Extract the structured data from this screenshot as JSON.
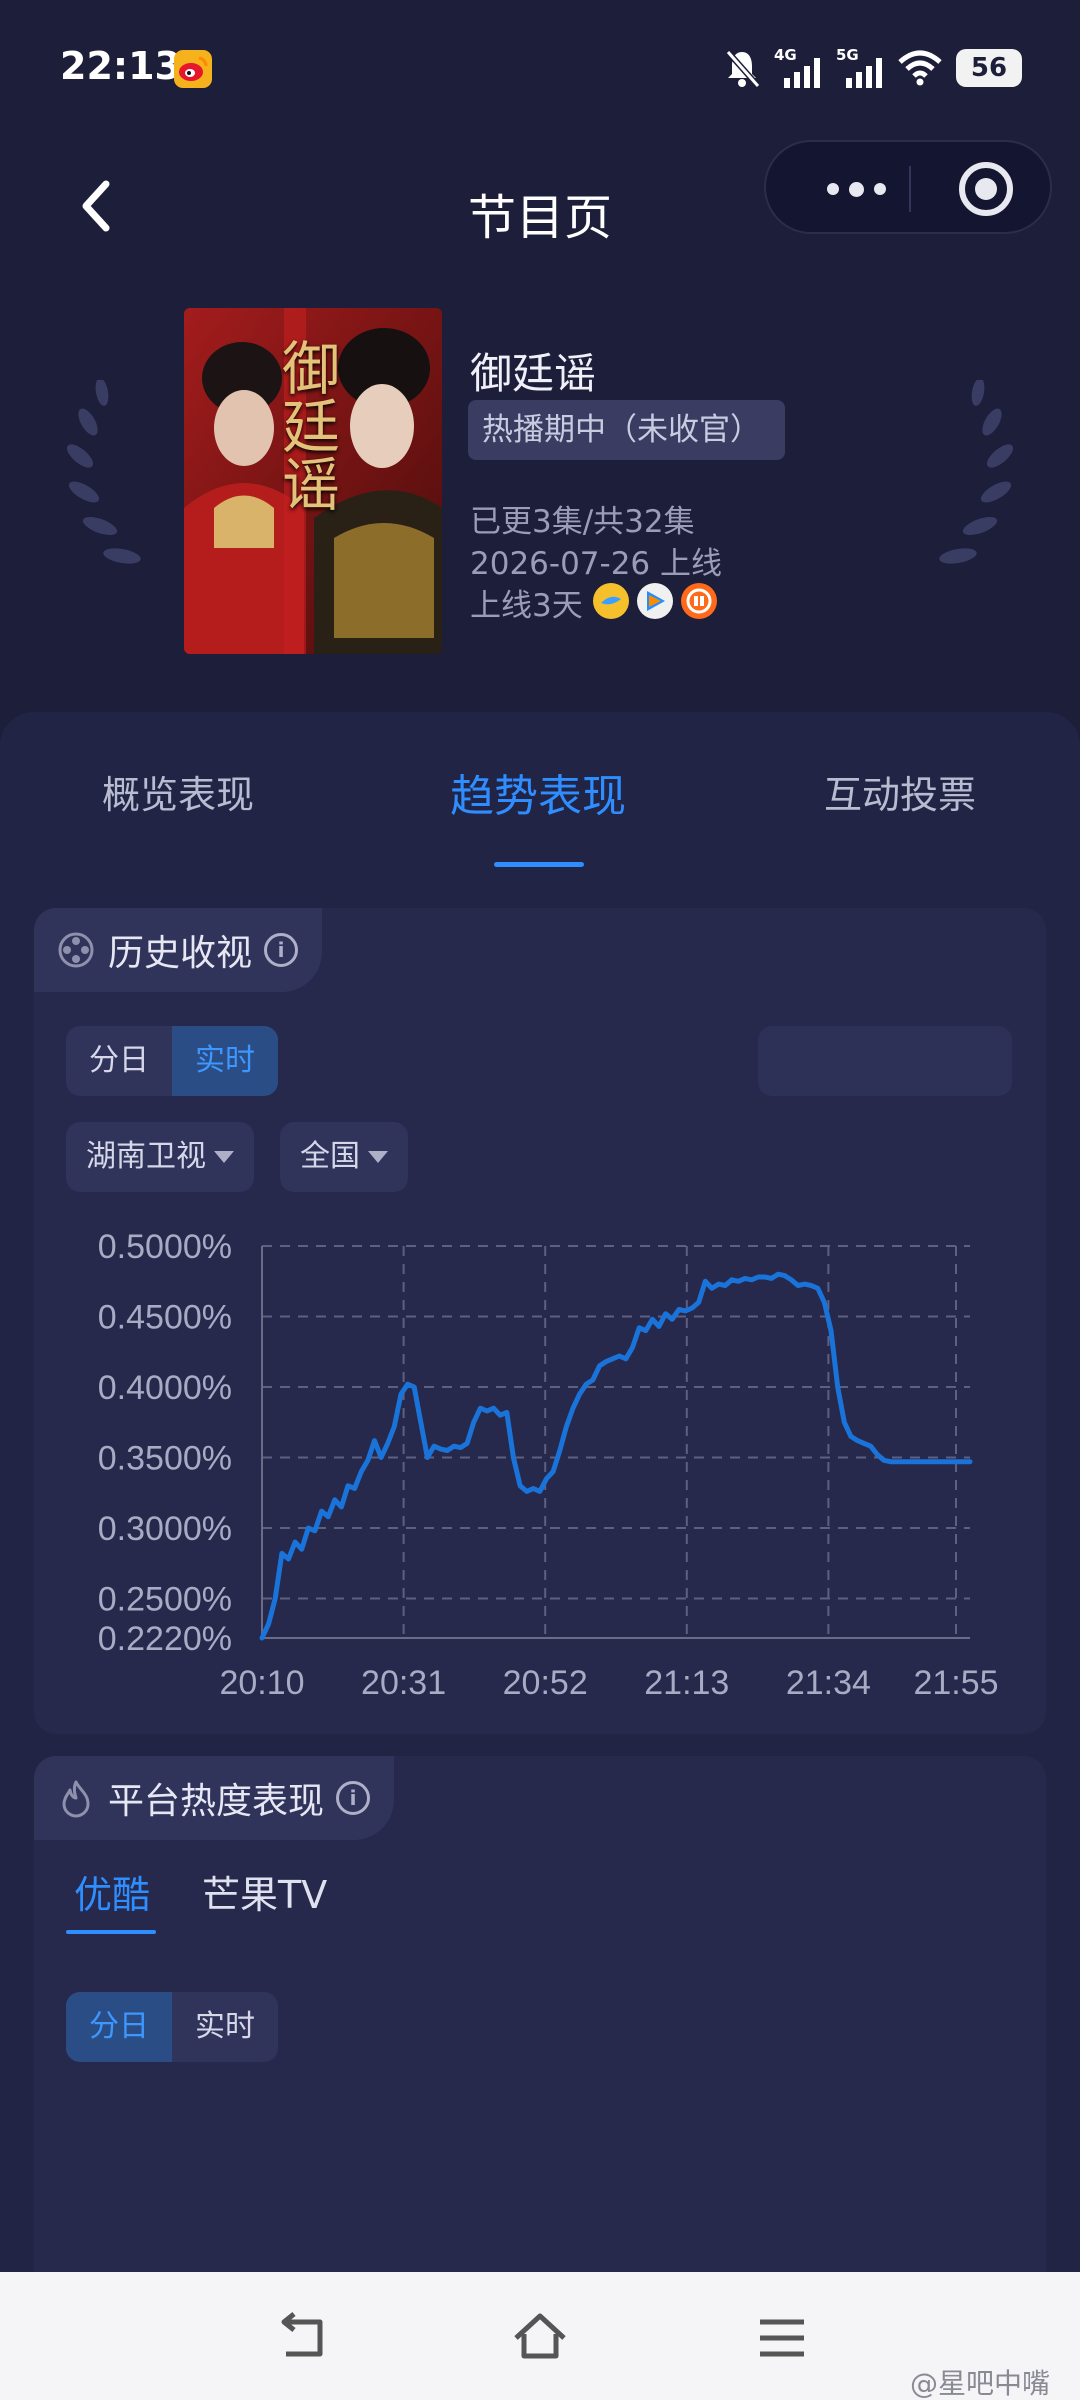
{
  "status_bar": {
    "time": "22:13",
    "network1": "4G",
    "network2": "5G",
    "battery": "56"
  },
  "header": {
    "title": "节目页"
  },
  "show": {
    "title": "御廷谣",
    "poster_text": "御廷谣",
    "status": "热播期中（未收官）",
    "episodes": "已更3集/共32集",
    "premiere": "2026-07-26 上线",
    "days_online": "上线3天",
    "platform_icons": [
      "youku-icon",
      "tencent-video-icon",
      "mango-tv-icon"
    ]
  },
  "tabs": [
    {
      "label": "概览表现"
    },
    {
      "label": "趋势表现"
    },
    {
      "label": "互动投票"
    }
  ],
  "history_section": {
    "title": "历史收视",
    "toggle": [
      "分日",
      "实时"
    ],
    "channel": "湖南卫视",
    "region": "全国"
  },
  "chart_data": {
    "type": "line",
    "title": "",
    "xlabel": "",
    "ylabel": "",
    "x_ticks": [
      "20:10",
      "20:31",
      "20:52",
      "21:13",
      "21:34",
      "21:55"
    ],
    "y_ticks": [
      "0.5000%",
      "0.4500%",
      "0.4000%",
      "0.3500%",
      "0.3000%",
      "0.2500%",
      "0.2220%"
    ],
    "y_tick_values": [
      0.5,
      0.45,
      0.4,
      0.35,
      0.3,
      0.25,
      0.222
    ],
    "ylim": [
      0.222,
      0.5
    ],
    "x_minutes_range": [
      0,
      107
    ],
    "grid": true,
    "series": [
      {
        "color": "#1a73d9",
        "x": [
          0,
          1,
          2,
          3,
          4,
          5,
          6,
          7,
          8,
          9,
          10,
          11,
          12,
          13,
          14,
          15,
          16,
          17,
          18,
          19,
          20,
          21,
          22,
          23,
          24,
          25,
          26,
          27,
          28,
          29,
          30,
          31,
          32,
          33,
          34,
          35,
          36,
          37,
          38,
          39,
          40,
          41,
          42,
          43,
          44,
          45,
          46,
          47,
          48,
          49,
          50,
          51,
          52,
          53,
          54,
          55,
          56,
          57,
          58,
          59,
          60,
          61,
          62,
          63,
          64,
          65,
          66,
          67,
          68,
          69,
          70,
          71,
          72,
          73,
          74,
          75,
          76,
          77,
          78,
          79,
          80,
          81,
          82,
          83,
          84,
          85,
          86,
          87,
          88,
          89,
          90,
          91,
          92,
          93,
          94,
          95,
          96,
          97,
          98,
          99,
          100,
          101,
          102,
          103,
          104,
          105,
          106,
          107
        ],
        "values": [
          0.222,
          0.232,
          0.25,
          0.282,
          0.278,
          0.29,
          0.285,
          0.3,
          0.298,
          0.312,
          0.308,
          0.32,
          0.315,
          0.33,
          0.328,
          0.34,
          0.348,
          0.362,
          0.35,
          0.36,
          0.372,
          0.395,
          0.402,
          0.4,
          0.375,
          0.35,
          0.358,
          0.356,
          0.355,
          0.358,
          0.357,
          0.36,
          0.375,
          0.385,
          0.383,
          0.385,
          0.38,
          0.382,
          0.35,
          0.33,
          0.326,
          0.328,
          0.326,
          0.335,
          0.34,
          0.355,
          0.372,
          0.385,
          0.395,
          0.402,
          0.405,
          0.415,
          0.418,
          0.42,
          0.422,
          0.42,
          0.428,
          0.442,
          0.44,
          0.448,
          0.443,
          0.452,
          0.448,
          0.455,
          0.454,
          0.456,
          0.46,
          0.475,
          0.47,
          0.473,
          0.472,
          0.476,
          0.475,
          0.477,
          0.476,
          0.478,
          0.478,
          0.477,
          0.48,
          0.479,
          0.476,
          0.472,
          0.473,
          0.472,
          0.47,
          0.46,
          0.44,
          0.4,
          0.375,
          0.365,
          0.362,
          0.36,
          0.358,
          0.352,
          0.348,
          0.347,
          0.347,
          0.347,
          0.347,
          0.347,
          0.347,
          0.347,
          0.347,
          0.347,
          0.347,
          0.347,
          0.347,
          0.347
        ]
      }
    ]
  },
  "platform_section": {
    "title": "平台热度表现",
    "sub_tabs": [
      "优酷",
      "芒果TV"
    ],
    "toggle": [
      "分日",
      "实时"
    ]
  },
  "watermark": "@星吧中嘴"
}
